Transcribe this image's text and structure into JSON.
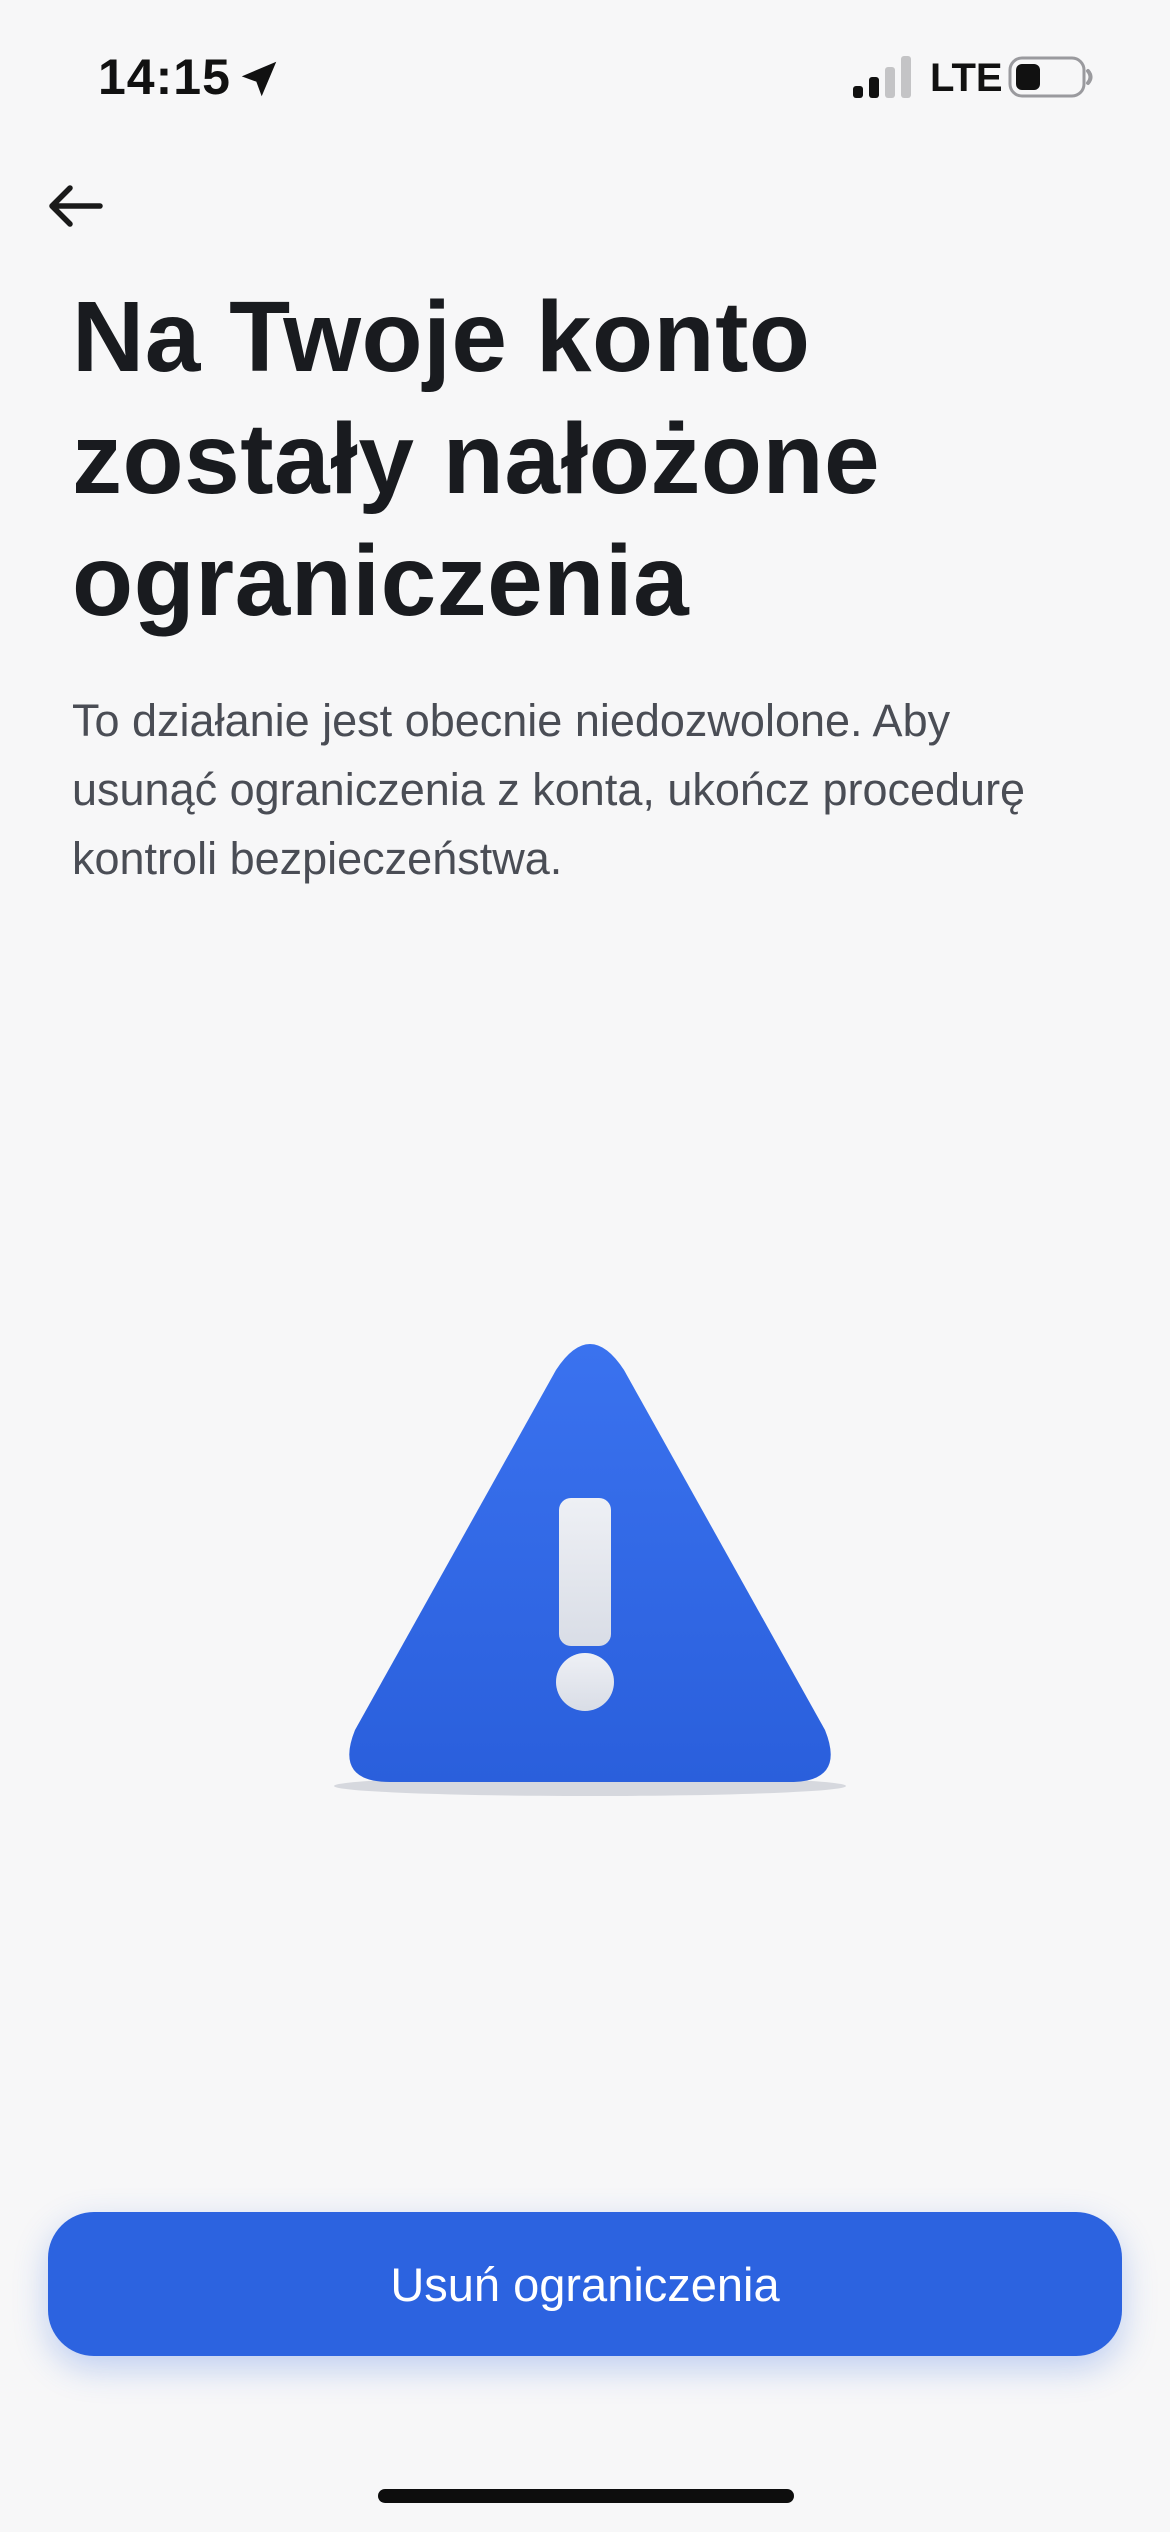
{
  "status_bar": {
    "time": "14:15",
    "network": "LTE",
    "icons": {
      "location": "location-arrow-icon",
      "signal": "cellular-signal-icon",
      "battery": "battery-icon"
    },
    "signal_bars_active": 2,
    "signal_bars_total": 4,
    "battery_level": 0.3
  },
  "navigation": {
    "back_icon": "arrow-left-icon"
  },
  "content": {
    "title": "Na Twoje konto zostały nałożone ograniczenia",
    "description": "To działanie jest obecnie niedozwolone. Aby usunąć ograniczenia z konta, ukończ procedurę kontroli bezpieczeństwa.",
    "illustration": "warning-triangle-icon"
  },
  "actions": {
    "primary_label": "Usuń ograniczenia"
  },
  "colors": {
    "background": "#f7f7f8",
    "accent": "#2c63e0",
    "title_text": "#191b1f",
    "body_text": "#4a4d55"
  }
}
